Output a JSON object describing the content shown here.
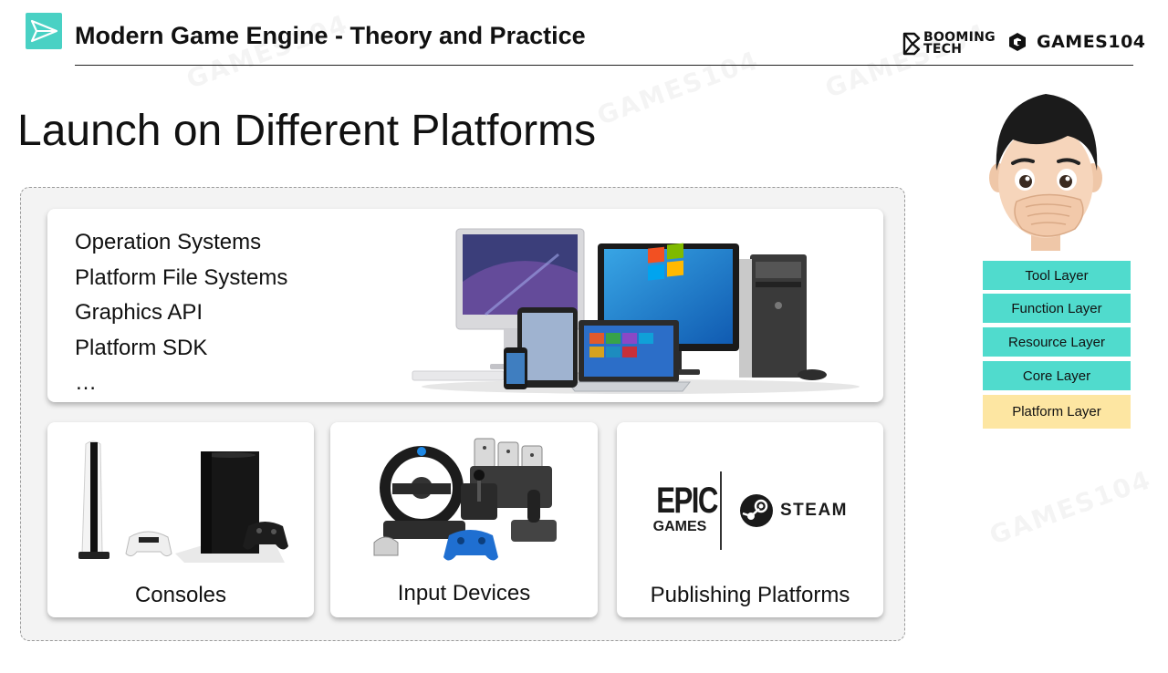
{
  "header": {
    "title": "Modern Game Engine - Theory and Practice",
    "brand_booming_line1": "BOOMING",
    "brand_booming_line2": "TECH",
    "brand_games": "GAMES104"
  },
  "slide": {
    "title": "Launch on Different Platforms"
  },
  "top_card": {
    "items": [
      "Operation Systems",
      "Platform File Systems",
      "Graphics API",
      "Platform SDK",
      "…"
    ]
  },
  "cards": {
    "consoles": "Consoles",
    "input_devices": "Input Devices",
    "publishing": "Publishing Platforms"
  },
  "publishing_logos": {
    "epic_line1": "EPIC",
    "epic_line2": "GAMES",
    "steam": "STEAM"
  },
  "layers": [
    {
      "label": "Tool Layer",
      "color": "#50dbcd"
    },
    {
      "label": "Function Layer",
      "color": "#50dbcd"
    },
    {
      "label": "Resource Layer",
      "color": "#50dbcd"
    },
    {
      "label": "Core Layer",
      "color": "#50dbcd"
    },
    {
      "label": "Platform Layer",
      "color": "#fde6a2"
    }
  ],
  "icons": [
    "send-logo-icon",
    "booming-tech-logo",
    "games104-logo",
    "avatar-illustration"
  ]
}
